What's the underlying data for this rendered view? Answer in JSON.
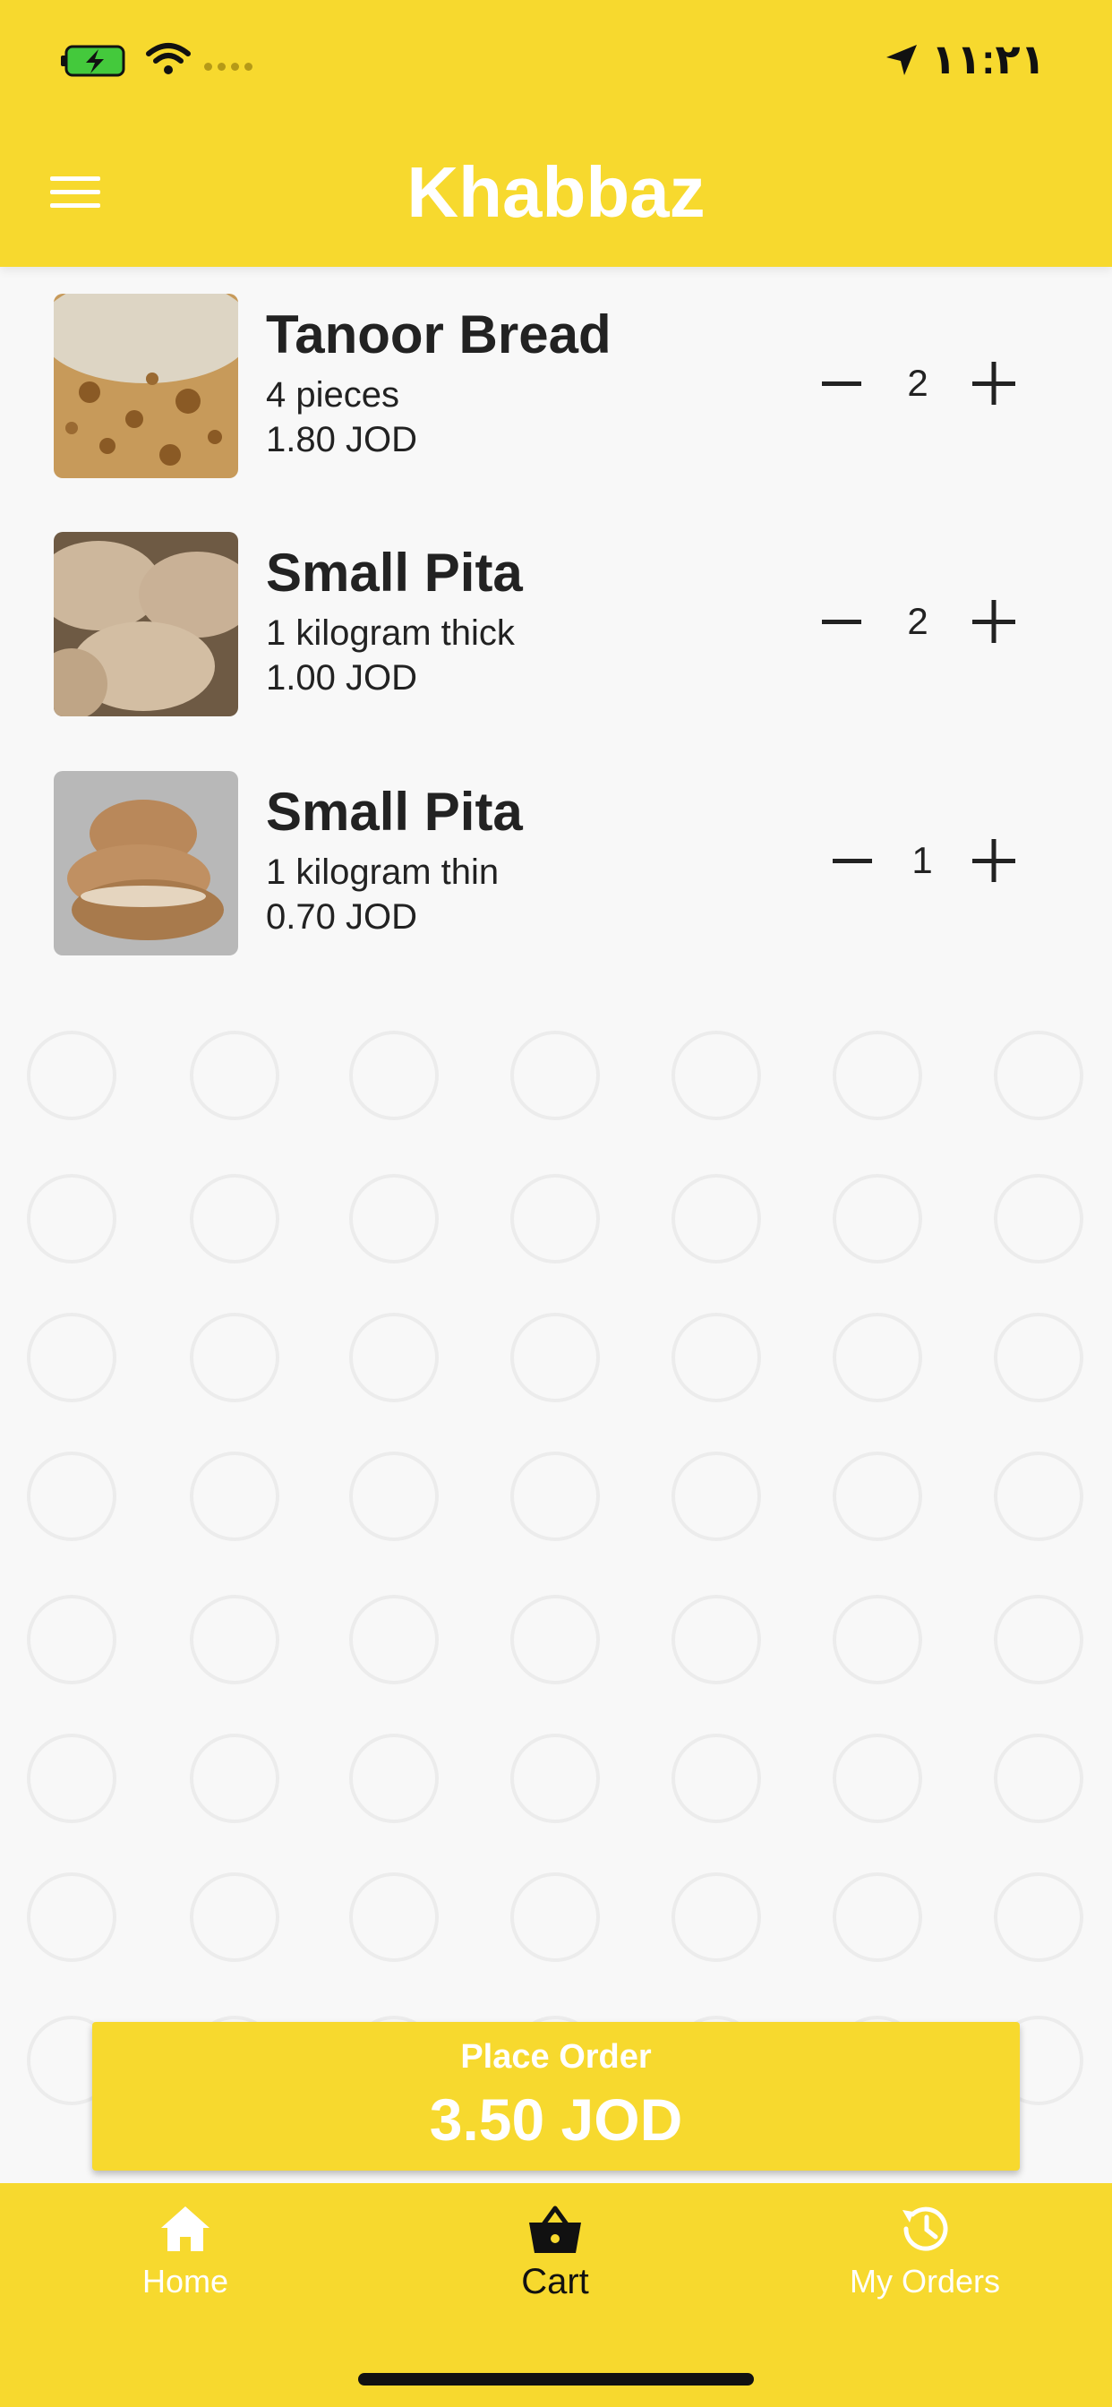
{
  "status_bar": {
    "time": "١١:٢١",
    "battery_icon": "battery-charging-icon",
    "wifi_icon": "wifi-icon",
    "location_icon": "location-arrow-icon"
  },
  "header": {
    "title": "Khabbaz",
    "menu_icon": "hamburger-menu-icon",
    "background_color": "#f7d92e"
  },
  "cart": {
    "items": [
      {
        "name": "Tanoor Bread",
        "description": "4 pieces",
        "price": "1.80 JOD",
        "quantity": "2",
        "image": "tanoor-bread-image"
      },
      {
        "name": "Small Pita",
        "description": "1 kilogram thick",
        "price": "1.00 JOD",
        "quantity": "2",
        "image": "pita-thick-image"
      },
      {
        "name": "Small Pita",
        "description": "1 kilogram thin",
        "price": "0.70 JOD",
        "quantity": "1",
        "image": "pita-thin-image"
      }
    ]
  },
  "order": {
    "place_order_label": "Place Order",
    "total": "3.50 JOD"
  },
  "tabs": [
    {
      "label": "Home",
      "icon": "home-icon",
      "active": false
    },
    {
      "label": "Cart",
      "icon": "basket-icon",
      "active": true
    },
    {
      "label": "My Orders",
      "icon": "history-icon",
      "active": false
    }
  ],
  "colors": {
    "accent": "#f7d92e",
    "text": "#222222",
    "background": "#f8f8f8"
  }
}
